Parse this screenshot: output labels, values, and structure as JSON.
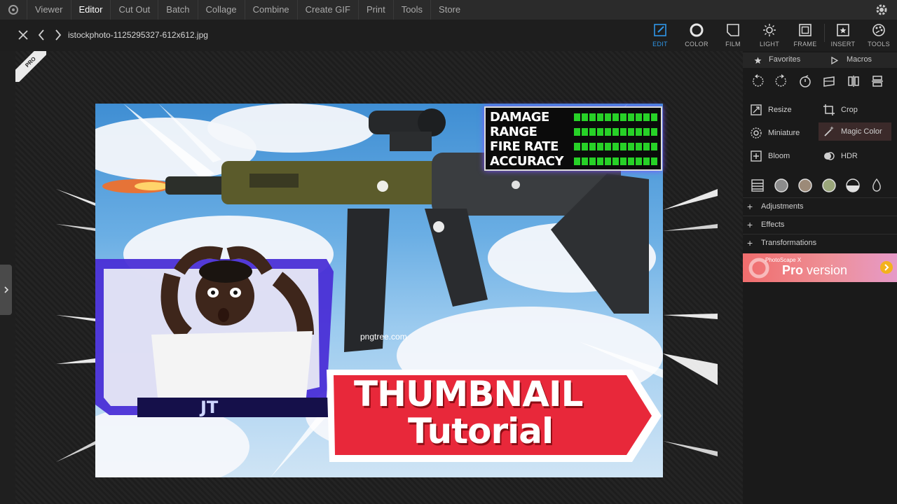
{
  "menu": {
    "items": [
      "Viewer",
      "Editor",
      "Cut Out",
      "Batch",
      "Collage",
      "Combine",
      "Create GIF",
      "Print",
      "Tools",
      "Store"
    ],
    "active": "Editor"
  },
  "toolbar": {
    "filename": "istockphoto-1125295327-612x612.jpg",
    "tools": [
      {
        "label": "EDIT",
        "icon": "edit-icon"
      },
      {
        "label": "COLOR",
        "icon": "color-icon"
      },
      {
        "label": "FILM",
        "icon": "film-icon"
      },
      {
        "label": "LIGHT",
        "icon": "light-icon"
      },
      {
        "label": "FRAME",
        "icon": "frame-icon"
      },
      {
        "label": "INSERT",
        "icon": "insert-icon"
      },
      {
        "label": "TOOLS",
        "icon": "tools-icon"
      }
    ],
    "active_tool": "EDIT",
    "accent": "#2f97e8"
  },
  "canvas": {
    "pro_badge": "PRO"
  },
  "thumbnail": {
    "stats": [
      "DAMAGE",
      "RANGE",
      "FIRE RATE",
      "ACCURACY"
    ],
    "stat_bar_color": "#27d127",
    "watermark": "pngtree.com",
    "banner_line1": "THUMBNAIL",
    "banner_line2": "Tutorial",
    "banner_color": "#e8283a",
    "frame_initials": "JT"
  },
  "panel": {
    "tab_favorites": "Favorites",
    "tab_macros": "Macros",
    "operations": [
      {
        "label": "Resize",
        "icon": "resize-icon"
      },
      {
        "label": "Crop",
        "icon": "crop-icon"
      },
      {
        "label": "Miniature",
        "icon": "miniature-icon"
      },
      {
        "label": "Magic Color",
        "icon": "magic-wand-icon"
      },
      {
        "label": "Bloom",
        "icon": "bloom-icon"
      },
      {
        "label": "HDR",
        "icon": "hdr-icon"
      }
    ],
    "sections": [
      "Adjustments",
      "Effects",
      "Transformations"
    ],
    "promo_small": "PhotoScape X",
    "promo_big_pro": "Pro",
    "promo_big_rest": " version"
  }
}
